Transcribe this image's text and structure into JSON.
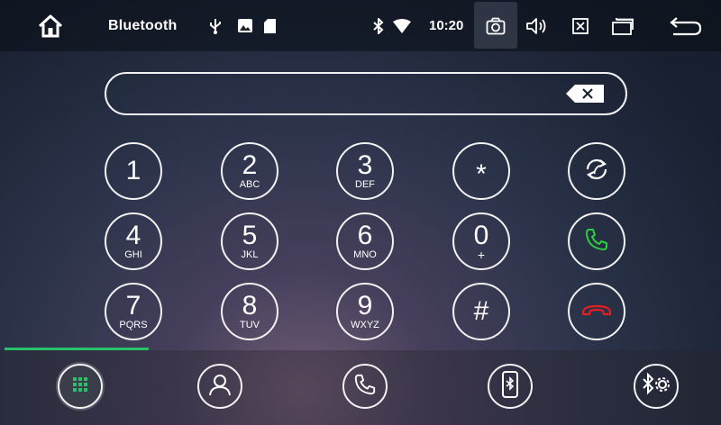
{
  "statusbar": {
    "title": "Bluetooth",
    "time": "10:20",
    "icons": [
      "home-icon",
      "usb-icon",
      "image-icon",
      "sd-card-icon",
      "bluetooth-icon",
      "wifi-icon",
      "camera-icon",
      "volume-icon",
      "close-window-icon",
      "recent-apps-icon",
      "back-icon"
    ]
  },
  "dialer": {
    "input_value": "",
    "keys": [
      {
        "digit": "1",
        "letters": ""
      },
      {
        "digit": "2",
        "letters": "ABC"
      },
      {
        "digit": "3",
        "letters": "DEF"
      },
      {
        "digit": "*",
        "letters": ""
      },
      {
        "digit": "4",
        "letters": "GHI"
      },
      {
        "digit": "5",
        "letters": "JKL"
      },
      {
        "digit": "6",
        "letters": "MNO"
      },
      {
        "digit": "0",
        "letters": "+"
      },
      {
        "digit": "7",
        "letters": "PQRS"
      },
      {
        "digit": "8",
        "letters": "TUV"
      },
      {
        "digit": "9",
        "letters": "WXYZ"
      },
      {
        "digit": "#",
        "letters": ""
      }
    ],
    "actions": [
      "reconnect-icon",
      "call-icon",
      "hang-up-icon"
    ]
  },
  "bottomnav": {
    "items": [
      "dialpad-icon",
      "contacts-icon",
      "call-log-icon",
      "phone-bluetooth-icon",
      "bluetooth-settings-icon"
    ],
    "active": "dialpad-icon",
    "progress": 0.2
  },
  "colors": {
    "accent": "#27c26a",
    "call": "#2ecc40",
    "hangup": "#e02020"
  }
}
